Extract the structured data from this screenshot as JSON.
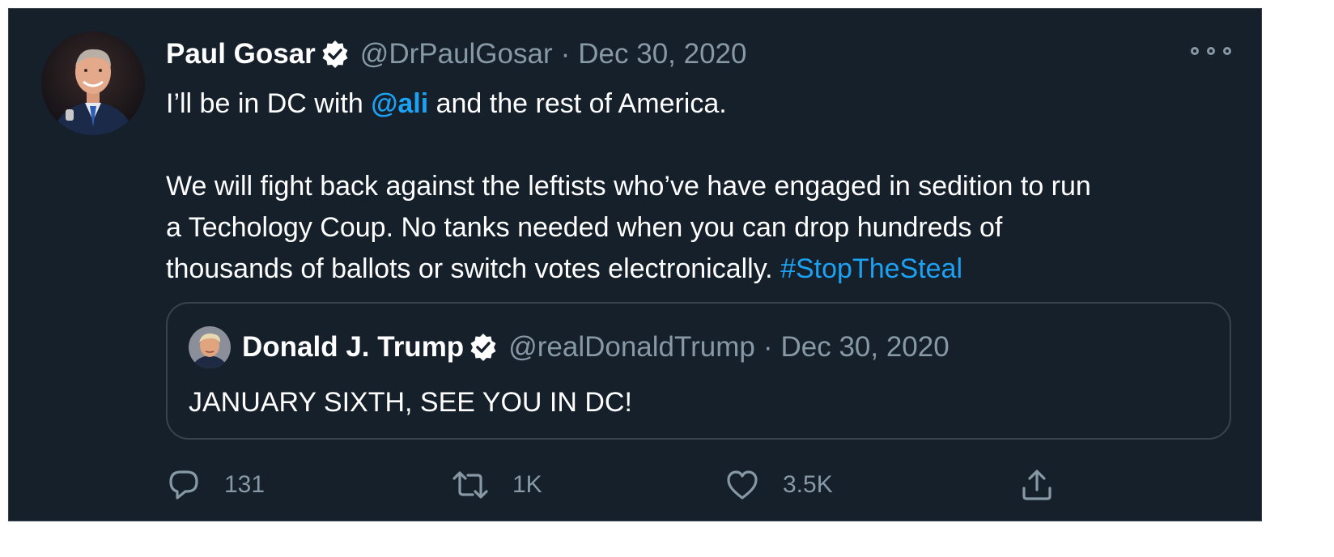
{
  "tweet": {
    "author": {
      "name": "Paul Gosar",
      "handle": "@DrPaulGosar",
      "verified": true
    },
    "separator": "·",
    "date": "Dec 30, 2020",
    "text": {
      "line1_before": "I’ll be in DC with ",
      "mention": "@ali",
      "line1_after": " and the rest of America.",
      "para2_line1": "We will fight back against the leftists who’ve have engaged in sedition to run",
      "para2_line2": "a Techology Coup.  No tanks needed when you can drop hundreds of",
      "para2_line3": "thousands of ballots or switch votes electronically.  ",
      "hashtag": "#StopTheSteal"
    },
    "more_icon": "ellipsis-icon"
  },
  "quoted_tweet": {
    "author": {
      "name": "Donald J. Trump",
      "handle": "@realDonaldTrump",
      "verified": true
    },
    "separator": "·",
    "date": "Dec 30, 2020",
    "text": "JANUARY SIXTH, SEE YOU IN DC!"
  },
  "actions": {
    "reply": {
      "icon": "reply-icon",
      "count": "131"
    },
    "retweet": {
      "icon": "retweet-icon",
      "count": "1K"
    },
    "like": {
      "icon": "heart-icon",
      "count": "3.5K"
    },
    "share": {
      "icon": "share-icon"
    }
  },
  "colors": {
    "background": "#15202b",
    "text": "#ffffff",
    "secondary_text": "#8899a6",
    "accent": "#1da1f2",
    "border": "#38444d"
  }
}
